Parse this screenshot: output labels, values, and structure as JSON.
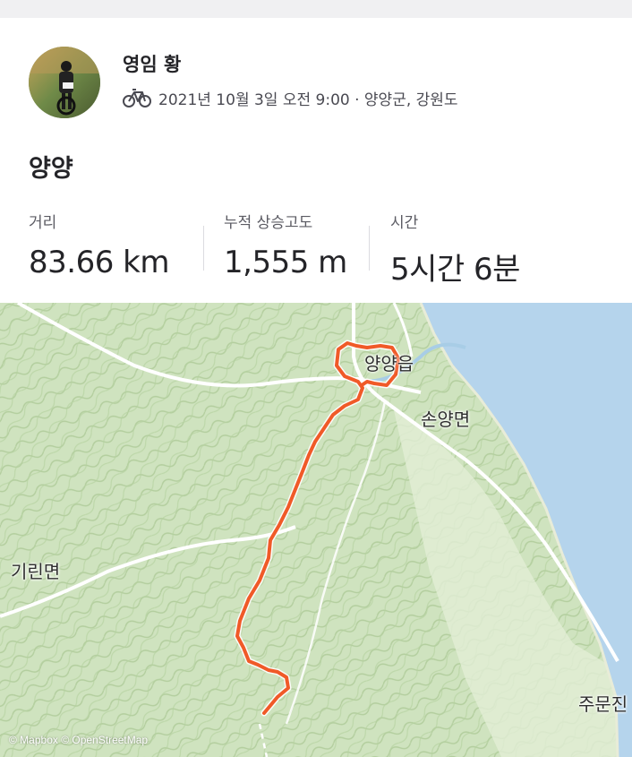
{
  "activity": {
    "athlete_name": "영임 황",
    "sport_icon": "bike-icon",
    "meta_text": "2021년 10월 3일 오전 9:00 · 양양군, 강원도",
    "title": "양양"
  },
  "stats": [
    {
      "label": "거리",
      "value": "83.66 km"
    },
    {
      "label": "누적 상승고도",
      "value": "1,555 m"
    },
    {
      "label": "시간",
      "value": "5시간 6분"
    }
  ],
  "map": {
    "labels": {
      "yangyang": "양양읍",
      "sonyang": "손양면",
      "girin": "기린면",
      "jumunjin": "주문진"
    },
    "attribution": "© Mapbox © OpenStreetMap",
    "route_color": "#f05a28",
    "water_color": "#b5d4ec",
    "terrain_color": "#cfe3bf"
  }
}
